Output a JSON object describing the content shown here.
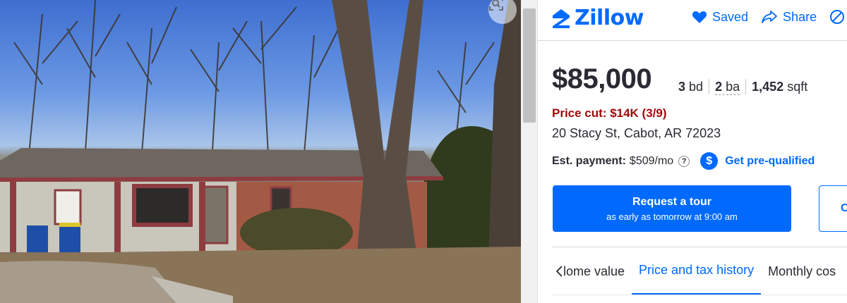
{
  "brand": {
    "name": "Zillow",
    "color": "#006aff"
  },
  "header_actions": [
    {
      "label": "Saved",
      "icon": "heart-icon"
    },
    {
      "label": "Share",
      "icon": "share-icon"
    },
    {
      "label": "",
      "icon": "hide-icon"
    }
  ],
  "listing": {
    "price": "$85,000",
    "beds_value": "3",
    "beds_unit": "bd",
    "baths_value": "2",
    "baths_unit": "ba",
    "sqft_value": "1,452",
    "sqft_unit": "sqft",
    "price_cut": "Price cut: $14K (3/9)",
    "address": "20 Stacy St, Cabot, AR 72023"
  },
  "payment": {
    "label": "Est. payment:",
    "value": "$509/mo",
    "help_glyph": "?",
    "prequal_glyph": "$",
    "prequal_label": "Get pre-qualified"
  },
  "tour_button": {
    "title": "Request a tour",
    "subtitle": "as early as tomorrow at 9:00 am"
  },
  "contact_button": {
    "label": "C"
  },
  "tabs": {
    "items": [
      "lome value",
      "Price and tax history",
      "Monthly cos"
    ],
    "active_index": 1
  },
  "colors": {
    "accent": "#006aff",
    "price_cut": "#a00a0a",
    "text": "#2a2a33"
  }
}
